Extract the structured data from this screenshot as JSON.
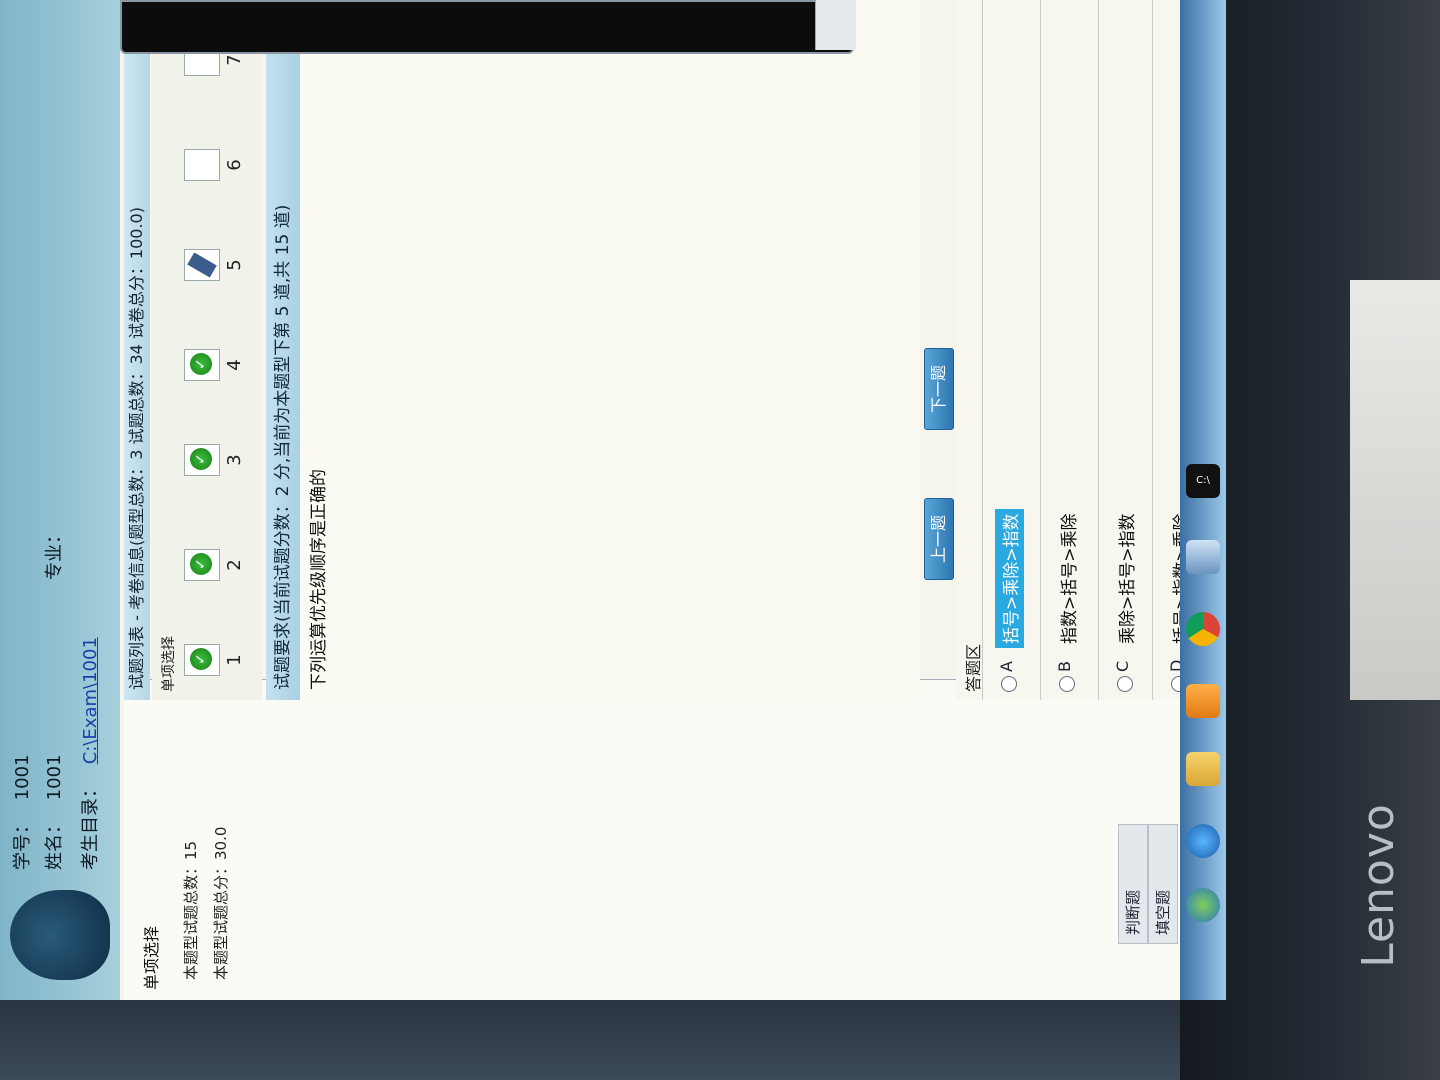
{
  "header": {
    "student_id_label": "学号：",
    "student_id_value": "1001",
    "name_label": "姓名：",
    "name_value": "1001",
    "major_label": "专业：",
    "major_value": "",
    "dir_label": "考生目录：",
    "dir_value": "C:\\Exam\\1001"
  },
  "left_panel": {
    "title": "单项选择",
    "count_line": "本题型试题总数：15",
    "score_line": "本题型试题总分：30.0",
    "other_types": [
      "判断题",
      "填空题"
    ]
  },
  "question_list": {
    "header": "试题列表 - 考卷信息(题型总数：3  试题总数：34  试卷总分：100.0)",
    "category": "单项选择",
    "items": [
      {
        "num": "1",
        "state": "done"
      },
      {
        "num": "2",
        "state": "done"
      },
      {
        "num": "3",
        "state": "done"
      },
      {
        "num": "4",
        "state": "done"
      },
      {
        "num": "5",
        "state": "current"
      },
      {
        "num": "6",
        "state": "todo"
      },
      {
        "num": "7",
        "state": "todo"
      }
    ]
  },
  "requirement": "试题要求(当前试题分数：2 分,当前为本题型下第 5 道,共 15 道)",
  "question_text": "下列运算优先级顺序是正确的",
  "nav": {
    "prev": "上一题",
    "next": "下一题"
  },
  "answer_area": {
    "title": "答题区",
    "options": [
      {
        "letter": "A",
        "text": "括号>乘除>指数",
        "selected": true
      },
      {
        "letter": "B",
        "text": "指数>括号>乘除",
        "selected": false
      },
      {
        "letter": "C",
        "text": "乘除>括号>指数",
        "selected": false
      },
      {
        "letter": "D",
        "text": "括号>指数>乘除",
        "selected": false
      }
    ]
  },
  "monitor_brand": "Lenovo",
  "colors": {
    "accent": "#2c76b3",
    "selected_option": "#2aa8e0",
    "header": "#a7d0dc"
  }
}
